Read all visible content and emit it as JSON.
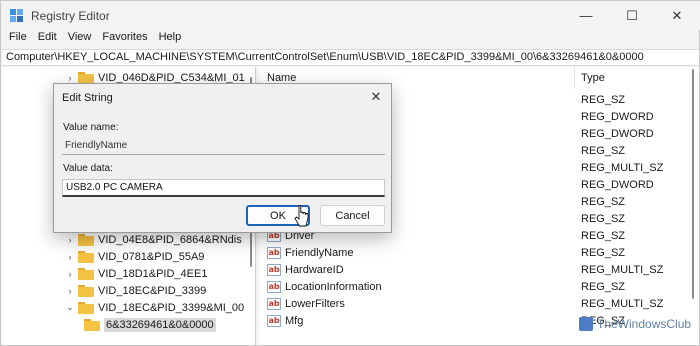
{
  "window": {
    "title": "Registry Editor"
  },
  "titlebar": {
    "minimize": "—",
    "maximize": "☐",
    "close": "✕"
  },
  "menu": [
    "File",
    "Edit",
    "View",
    "Favorites",
    "Help"
  ],
  "address": "Computer\\HKEY_LOCAL_MACHINE\\SYSTEM\\CurrentControlSet\\Enum\\USB\\VID_18EC&PID_3399&MI_00\\6&33269461&0&0000",
  "tree": [
    {
      "label": "VID_046D&PID_C534&MI_01",
      "expanded": false
    },
    {
      "label": "VID_04E8&PID_6864&RNdis",
      "expanded": false
    },
    {
      "label": "VID_0781&PID_55A9",
      "expanded": false
    },
    {
      "label": "VID_18D1&PID_4EE1",
      "expanded": false
    },
    {
      "label": "VID_18EC&PID_3399",
      "expanded": false
    },
    {
      "label": "VID_18EC&PID_3399&MI_00",
      "expanded": true
    },
    {
      "label": "6&33269461&0&0000",
      "selected": true
    }
  ],
  "list": {
    "columns": {
      "name": "Name",
      "type": "Type"
    },
    "rows": [
      {
        "name": "",
        "type": "REG_SZ"
      },
      {
        "name": "",
        "type": "REG_DWORD"
      },
      {
        "name": "",
        "type": "REG_DWORD"
      },
      {
        "name": "",
        "type": "REG_SZ"
      },
      {
        "name": "",
        "type": "REG_MULTI_SZ"
      },
      {
        "name": "",
        "type": "REG_DWORD"
      },
      {
        "name": "",
        "type": "REG_SZ"
      },
      {
        "name": "",
        "type": "REG_SZ"
      },
      {
        "name": "Driver",
        "type": "REG_SZ"
      },
      {
        "name": "FriendlyName",
        "type": "REG_SZ"
      },
      {
        "name": "HardwareID",
        "type": "REG_MULTI_SZ"
      },
      {
        "name": "LocationInformation",
        "type": "REG_SZ"
      },
      {
        "name": "LowerFilters",
        "type": "REG_MULTI_SZ"
      },
      {
        "name": "Mfg",
        "type": "REG_SZ"
      }
    ]
  },
  "dialog": {
    "title": "Edit String",
    "value_name_label": "Value name:",
    "value_name": "FriendlyName",
    "value_data_label": "Value data:",
    "value_data": "USB2.0 PC CAMERA",
    "ok_label": "OK",
    "cancel_label": "Cancel"
  },
  "icons": {
    "string_value": "ab",
    "folder": "folder-icon"
  },
  "watermark": "TheWindowsClub",
  "colors": {
    "accent": "#1e63b8",
    "folder": "#f5c344"
  }
}
